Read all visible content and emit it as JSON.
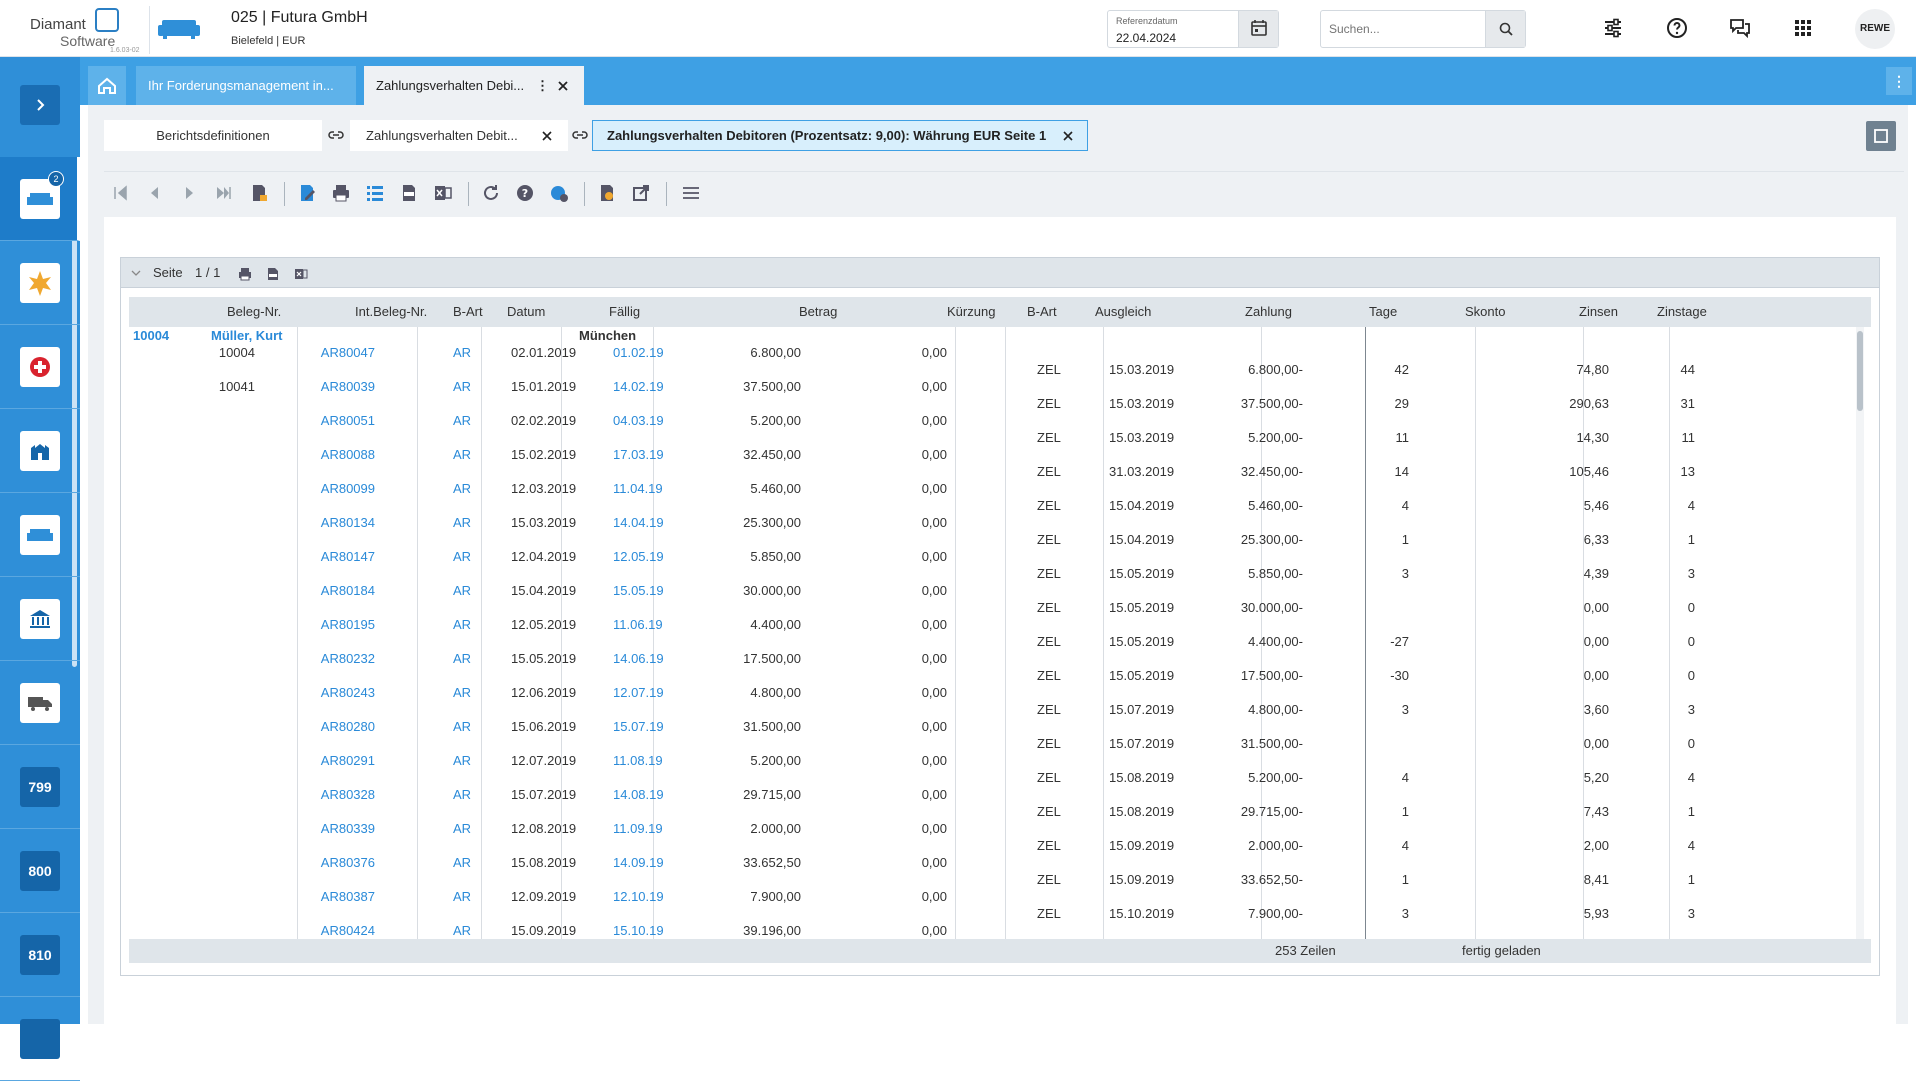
{
  "header": {
    "logo_line1": "Diamant",
    "logo_line2": "Software",
    "version": "1.6.03-02",
    "company": "025 | Futura GmbH",
    "location": "Bielefeld | EUR",
    "refdate_label": "Referenzdatum",
    "refdate_value": "22.04.2024",
    "search_placeholder": "Suchen...",
    "user": "REWE"
  },
  "sidebar": {
    "badge": "2",
    "numbers": [
      "799",
      "800",
      "810"
    ]
  },
  "tabs": {
    "tab1": "Ihr Forderungsmanagement in...",
    "tab2": "Zahlungsverhalten Debi...",
    "menu": "⋮"
  },
  "breadcrumbs": {
    "b1": "Berichtsdefinitionen",
    "b2": "Zahlungsverhalten Debit...",
    "b3": "Zahlungsverhalten Debitoren (Prozentsatz: 9,00): Währung EUR Seite 1"
  },
  "report": {
    "page_label": "Seite",
    "page_value": "1 / 1",
    "columns": [
      "Beleg-Nr.",
      "Int.Beleg-Nr.",
      "B-Art",
      "Datum",
      "Fällig",
      "Betrag",
      "Kürzung",
      "B-Art",
      "Ausgleich",
      "Zahlung",
      "Tage",
      "Skonto",
      "Zinsen",
      "Zinstage"
    ],
    "group": {
      "nr": "10004",
      "name": "Müller, Kurt",
      "city": "München"
    },
    "invoices": [
      {
        "beleg": "10004",
        "int": "AR80047",
        "art": "AR",
        "datum": "02.01.2019",
        "faellig": "01.02.19",
        "betrag": "6.800,00",
        "kuerzung": "0,00"
      },
      {
        "beleg": "10041",
        "int": "AR80039",
        "art": "AR",
        "datum": "15.01.2019",
        "faellig": "14.02.19",
        "betrag": "37.500,00",
        "kuerzung": "0,00"
      },
      {
        "beleg": "",
        "int": "AR80051",
        "art": "AR",
        "datum": "02.02.2019",
        "faellig": "04.03.19",
        "betrag": "5.200,00",
        "kuerzung": "0,00"
      },
      {
        "beleg": "",
        "int": "AR80088",
        "art": "AR",
        "datum": "15.02.2019",
        "faellig": "17.03.19",
        "betrag": "32.450,00",
        "kuerzung": "0,00"
      },
      {
        "beleg": "",
        "int": "AR80099",
        "art": "AR",
        "datum": "12.03.2019",
        "faellig": "11.04.19",
        "betrag": "5.460,00",
        "kuerzung": "0,00"
      },
      {
        "beleg": "",
        "int": "AR80134",
        "art": "AR",
        "datum": "15.03.2019",
        "faellig": "14.04.19",
        "betrag": "25.300,00",
        "kuerzung": "0,00"
      },
      {
        "beleg": "",
        "int": "AR80147",
        "art": "AR",
        "datum": "12.04.2019",
        "faellig": "12.05.19",
        "betrag": "5.850,00",
        "kuerzung": "0,00"
      },
      {
        "beleg": "",
        "int": "AR80184",
        "art": "AR",
        "datum": "15.04.2019",
        "faellig": "15.05.19",
        "betrag": "30.000,00",
        "kuerzung": "0,00"
      },
      {
        "beleg": "",
        "int": "AR80195",
        "art": "AR",
        "datum": "12.05.2019",
        "faellig": "11.06.19",
        "betrag": "4.400,00",
        "kuerzung": "0,00"
      },
      {
        "beleg": "",
        "int": "AR80232",
        "art": "AR",
        "datum": "15.05.2019",
        "faellig": "14.06.19",
        "betrag": "17.500,00",
        "kuerzung": "0,00"
      },
      {
        "beleg": "",
        "int": "AR80243",
        "art": "AR",
        "datum": "12.06.2019",
        "faellig": "12.07.19",
        "betrag": "4.800,00",
        "kuerzung": "0,00"
      },
      {
        "beleg": "",
        "int": "AR80280",
        "art": "AR",
        "datum": "15.06.2019",
        "faellig": "15.07.19",
        "betrag": "31.500,00",
        "kuerzung": "0,00"
      },
      {
        "beleg": "",
        "int": "AR80291",
        "art": "AR",
        "datum": "12.07.2019",
        "faellig": "11.08.19",
        "betrag": "5.200,00",
        "kuerzung": "0,00"
      },
      {
        "beleg": "",
        "int": "AR80328",
        "art": "AR",
        "datum": "15.07.2019",
        "faellig": "14.08.19",
        "betrag": "29.715,00",
        "kuerzung": "0,00"
      },
      {
        "beleg": "",
        "int": "AR80339",
        "art": "AR",
        "datum": "12.08.2019",
        "faellig": "11.09.19",
        "betrag": "2.000,00",
        "kuerzung": "0,00"
      },
      {
        "beleg": "",
        "int": "AR80376",
        "art": "AR",
        "datum": "15.08.2019",
        "faellig": "14.09.19",
        "betrag": "33.652,50",
        "kuerzung": "0,00"
      },
      {
        "beleg": "",
        "int": "AR80387",
        "art": "AR",
        "datum": "12.09.2019",
        "faellig": "12.10.19",
        "betrag": "7.900,00",
        "kuerzung": "0,00"
      },
      {
        "beleg": "",
        "int": "AR80424",
        "art": "AR",
        "datum": "15.09.2019",
        "faellig": "15.10.19",
        "betrag": "39.196,00",
        "kuerzung": "0,00"
      }
    ],
    "payments": [
      {
        "art": "ZEL",
        "ausgleich": "15.03.2019",
        "zahlung": "6.800,00-",
        "tage": "42",
        "skonto": "",
        "zinsen": "74,80",
        "zinstage": "44"
      },
      {
        "art": "ZEL",
        "ausgleich": "15.03.2019",
        "zahlung": "37.500,00-",
        "tage": "29",
        "skonto": "",
        "zinsen": "290,63",
        "zinstage": "31"
      },
      {
        "art": "ZEL",
        "ausgleich": "15.03.2019",
        "zahlung": "5.200,00-",
        "tage": "11",
        "skonto": "",
        "zinsen": "14,30",
        "zinstage": "11"
      },
      {
        "art": "ZEL",
        "ausgleich": "31.03.2019",
        "zahlung": "32.450,00-",
        "tage": "14",
        "skonto": "",
        "zinsen": "105,46",
        "zinstage": "13"
      },
      {
        "art": "ZEL",
        "ausgleich": "15.04.2019",
        "zahlung": "5.460,00-",
        "tage": "4",
        "skonto": "",
        "zinsen": "5,46",
        "zinstage": "4"
      },
      {
        "art": "ZEL",
        "ausgleich": "15.04.2019",
        "zahlung": "25.300,00-",
        "tage": "1",
        "skonto": "",
        "zinsen": "6,33",
        "zinstage": "1"
      },
      {
        "art": "ZEL",
        "ausgleich": "15.05.2019",
        "zahlung": "5.850,00-",
        "tage": "3",
        "skonto": "",
        "zinsen": "4,39",
        "zinstage": "3"
      },
      {
        "art": "ZEL",
        "ausgleich": "15.05.2019",
        "zahlung": "30.000,00-",
        "tage": "",
        "skonto": "",
        "zinsen": "0,00",
        "zinstage": "0"
      },
      {
        "art": "ZEL",
        "ausgleich": "15.05.2019",
        "zahlung": "4.400,00-",
        "tage": "-27",
        "skonto": "",
        "zinsen": "0,00",
        "zinstage": "0"
      },
      {
        "art": "ZEL",
        "ausgleich": "15.05.2019",
        "zahlung": "17.500,00-",
        "tage": "-30",
        "skonto": "",
        "zinsen": "0,00",
        "zinstage": "0"
      },
      {
        "art": "ZEL",
        "ausgleich": "15.07.2019",
        "zahlung": "4.800,00-",
        "tage": "3",
        "skonto": "",
        "zinsen": "3,60",
        "zinstage": "3"
      },
      {
        "art": "ZEL",
        "ausgleich": "15.07.2019",
        "zahlung": "31.500,00-",
        "tage": "",
        "skonto": "",
        "zinsen": "0,00",
        "zinstage": "0"
      },
      {
        "art": "ZEL",
        "ausgleich": "15.08.2019",
        "zahlung": "5.200,00-",
        "tage": "4",
        "skonto": "",
        "zinsen": "5,20",
        "zinstage": "4"
      },
      {
        "art": "ZEL",
        "ausgleich": "15.08.2019",
        "zahlung": "29.715,00-",
        "tage": "1",
        "skonto": "",
        "zinsen": "7,43",
        "zinstage": "1"
      },
      {
        "art": "ZEL",
        "ausgleich": "15.09.2019",
        "zahlung": "2.000,00-",
        "tage": "4",
        "skonto": "",
        "zinsen": "2,00",
        "zinstage": "4"
      },
      {
        "art": "ZEL",
        "ausgleich": "15.09.2019",
        "zahlung": "33.652,50-",
        "tage": "1",
        "skonto": "",
        "zinsen": "8,41",
        "zinstage": "1"
      },
      {
        "art": "ZEL",
        "ausgleich": "15.10.2019",
        "zahlung": "7.900,00-",
        "tage": "3",
        "skonto": "",
        "zinsen": "5,93",
        "zinstage": "3"
      }
    ],
    "footer_rows": "253 Zeilen",
    "footer_status": "fertig geladen"
  },
  "colors": {
    "accent": "#3ea0e4",
    "link": "#2a8ad8",
    "sidebar": "#2f8fd8"
  }
}
